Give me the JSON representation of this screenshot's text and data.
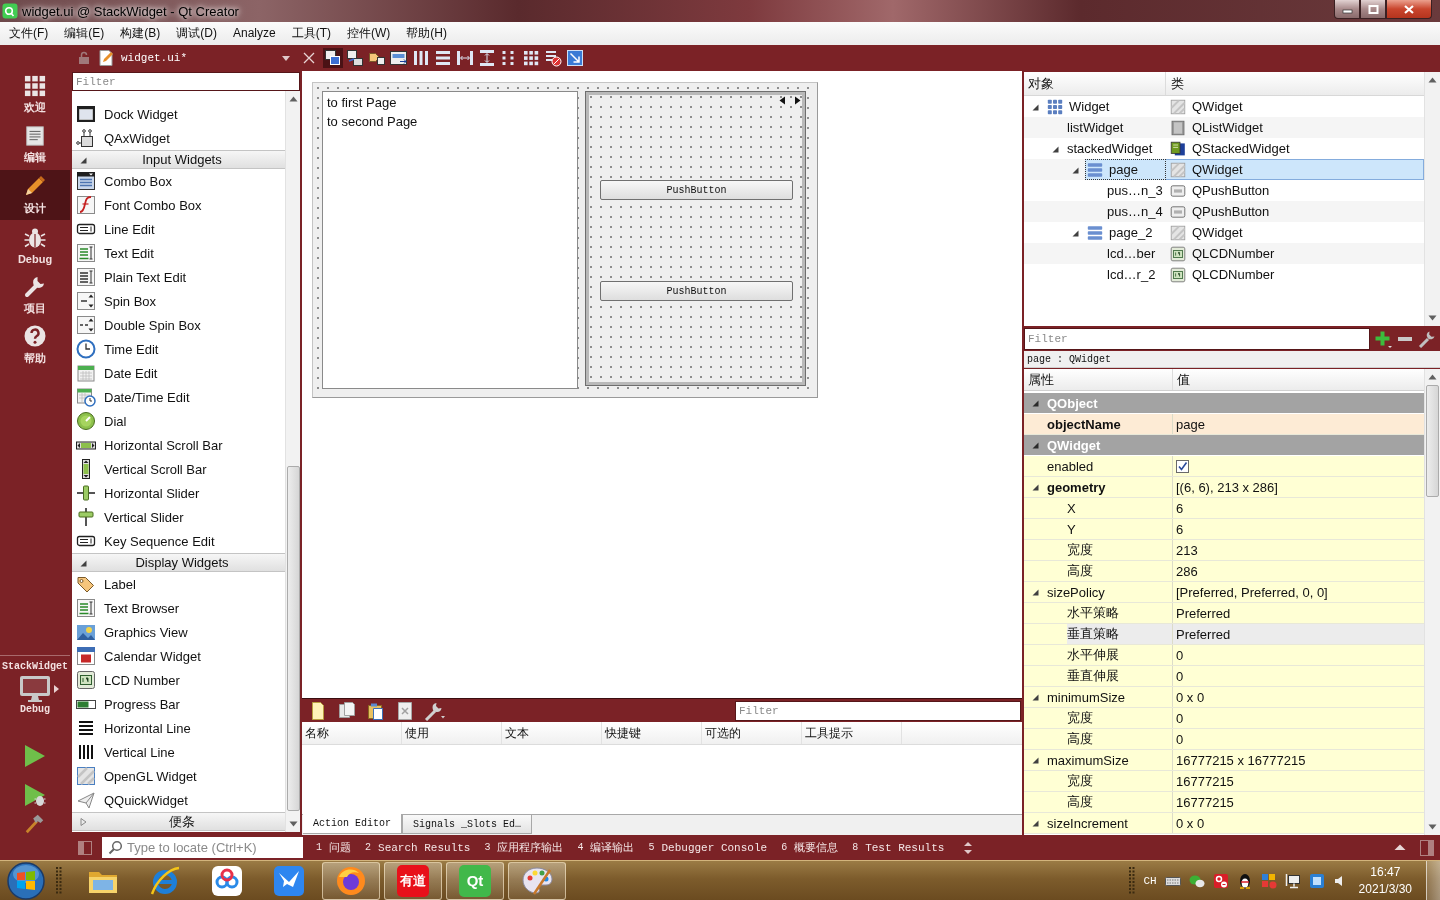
{
  "window": {
    "title": "widget.ui @ StackWidget - Qt Creator"
  },
  "menu": [
    "文件(F)",
    "编辑(E)",
    "构建(B)",
    "调试(D)",
    "Analyze",
    "工具(T)",
    "控件(W)",
    "帮助(H)"
  ],
  "modes": [
    {
      "label": "欢迎",
      "kind": "welcome",
      "selected": false
    },
    {
      "label": "编辑",
      "kind": "edit",
      "selected": false
    },
    {
      "label": "设计",
      "kind": "design",
      "selected": true
    },
    {
      "label": "Debug",
      "kind": "debug",
      "selected": false
    },
    {
      "label": "项目",
      "kind": "projects",
      "selected": false
    },
    {
      "label": "帮助",
      "kind": "help",
      "selected": false
    }
  ],
  "target": {
    "project": "StackWidget",
    "config": "Debug"
  },
  "editor_toolbar": {
    "document": "widget.ui*",
    "tools": [
      {
        "kind": "widgets",
        "checked": true
      },
      {
        "kind": "signals",
        "checked": false
      },
      {
        "kind": "buddies",
        "checked": false
      },
      {
        "kind": "taborder",
        "checked": false
      },
      {
        "kind": "hlayout",
        "checked": false
      },
      {
        "kind": "vlayout",
        "checked": false
      },
      {
        "kind": "hsplit",
        "checked": false
      },
      {
        "kind": "vsplit",
        "checked": false
      },
      {
        "kind": "formlayout",
        "checked": false
      },
      {
        "kind": "grid",
        "checked": false
      },
      {
        "kind": "break",
        "checked": false
      },
      {
        "kind": "adjust",
        "checked": false
      }
    ]
  },
  "widget_box": {
    "filter_placeholder": "Filter",
    "groups": [
      {
        "items": [
          {
            "label": "Dock Widget",
            "kind": "dock"
          },
          {
            "label": "QAxWidget",
            "kind": "activex"
          }
        ]
      },
      {
        "title": "Input Widgets",
        "expanded": true,
        "items": [
          {
            "label": "Combo Box",
            "kind": "combo"
          },
          {
            "label": "Font Combo Box",
            "kind": "font"
          },
          {
            "label": "Line Edit",
            "kind": "lineedit"
          },
          {
            "label": "Text Edit",
            "kind": "textedit"
          },
          {
            "label": "Plain Text Edit",
            "kind": "plaintext"
          },
          {
            "label": "Spin Box",
            "kind": "spin"
          },
          {
            "label": "Double Spin Box",
            "kind": "doublespin"
          },
          {
            "label": "Time Edit",
            "kind": "time"
          },
          {
            "label": "Date Edit",
            "kind": "date"
          },
          {
            "label": "Date/Time Edit",
            "kind": "datetime"
          },
          {
            "label": "Dial",
            "kind": "dial"
          },
          {
            "label": "Horizontal Scroll Bar",
            "kind": "hscroll"
          },
          {
            "label": "Vertical Scroll Bar",
            "kind": "vscroll"
          },
          {
            "label": "Horizontal Slider",
            "kind": "hslider"
          },
          {
            "label": "Vertical Slider",
            "kind": "vslider"
          },
          {
            "label": "Key Sequence Edit",
            "kind": "keyseq"
          }
        ]
      },
      {
        "title": "Display Widgets",
        "expanded": true,
        "items": [
          {
            "label": "Label",
            "kind": "label"
          },
          {
            "label": "Text Browser",
            "kind": "browser"
          },
          {
            "label": "Graphics View",
            "kind": "graphics"
          },
          {
            "label": "Calendar Widget",
            "kind": "calendar"
          },
          {
            "label": "LCD Number",
            "kind": "lcd"
          },
          {
            "label": "Progress Bar",
            "kind": "progress"
          },
          {
            "label": "Horizontal Line",
            "kind": "hline"
          },
          {
            "label": "Vertical Line",
            "kind": "vline"
          },
          {
            "label": "OpenGL Widget",
            "kind": "opengl"
          },
          {
            "label": "QQuickWidget",
            "kind": "quick"
          }
        ]
      },
      {
        "title": "便条",
        "expanded": false
      }
    ]
  },
  "form": {
    "list_items": [
      "to first Page",
      "to second Page"
    ],
    "buttons": [
      "PushButton",
      "PushButton"
    ]
  },
  "action_editor": {
    "filter_placeholder": "Filter",
    "columns": [
      "名称",
      "使用",
      "文本",
      "快捷键",
      "可选的",
      "工具提示"
    ],
    "tabs": [
      {
        "label": "Action Editor",
        "selected": true
      },
      {
        "label": "Signals _Slots Ed…",
        "selected": false
      }
    ]
  },
  "object_inspector": {
    "columns": [
      "对象",
      "类"
    ],
    "tree": [
      {
        "name": "Widget",
        "class": "QWidget",
        "kind": "widget",
        "layout": {
          "kind": "grid"
        },
        "expanded": true,
        "selected": false,
        "children": [
          {
            "name": "listWidget",
            "class": "QListWidget",
            "kind": "list",
            "selected": false
          },
          {
            "name": "stackedWidget",
            "class": "QStackedWidget",
            "kind": "stacked",
            "expanded": true,
            "selected": false,
            "children": [
              {
                "name": "page",
                "class": "QWidget",
                "kind": "widget",
                "layout": {
                  "kind": "vertical"
                },
                "expanded": true,
                "selected": true,
                "children": [
                  {
                    "name": "pus…n_3",
                    "class": "QPushButton",
                    "kind": "button",
                    "selected": false
                  },
                  {
                    "name": "pus…n_4",
                    "class": "QPushButton",
                    "kind": "button",
                    "selected": false
                  }
                ]
              },
              {
                "name": "page_2",
                "class": "QWidget",
                "kind": "widget",
                "layout": {
                  "kind": "vertical"
                },
                "expanded": true,
                "selected": false,
                "children": [
                  {
                    "name": "lcd…ber",
                    "class": "QLCDNumber",
                    "kind": "lcd",
                    "selected": false
                  },
                  {
                    "name": "lcd…r_2",
                    "class": "QLCDNumber",
                    "kind": "lcd",
                    "selected": false
                  }
                ]
              }
            ]
          }
        ]
      }
    ]
  },
  "property_editor": {
    "filter_placeholder": "Filter",
    "class_label": "page : QWidget",
    "columns": [
      "属性",
      "值"
    ],
    "groups": [
      {
        "name": "QObject",
        "expanded": true,
        "color": "#fdebd5",
        "properties": [
          {
            "name": "objectName",
            "kind": "text",
            "value": "page",
            "changed": true,
            "selected": false
          }
        ]
      },
      {
        "name": "QWidget",
        "expanded": true,
        "color": "#ffffd4",
        "properties": [
          {
            "name": "enabled",
            "kind": "checkbox",
            "checked": true,
            "changed": false,
            "selected": false
          },
          {
            "name": "geometry",
            "kind": "text",
            "value": "[(6, 6), 213 x 286]",
            "changed": true,
            "expanded": true,
            "selected": false,
            "children": [
              {
                "name": "X",
                "value": "6",
                "selected": false
              },
              {
                "name": "Y",
                "value": "6",
                "selected": false
              },
              {
                "name": "宽度",
                "value": "213",
                "selected": false
              },
              {
                "name": "高度",
                "value": "286",
                "selected": false
              }
            ]
          },
          {
            "name": "sizePolicy",
            "kind": "text",
            "value": "[Preferred, Preferred, 0, 0]",
            "changed": false,
            "expanded": true,
            "selected": false,
            "children": [
              {
                "name": "水平策略",
                "value": "Preferred",
                "selected": false
              },
              {
                "name": "垂直策略",
                "value": "Preferred",
                "selected": true
              },
              {
                "name": "水平伸展",
                "value": "0",
                "selected": false
              },
              {
                "name": "垂直伸展",
                "value": "0",
                "selected": false
              }
            ]
          },
          {
            "name": "minimumSize",
            "kind": "text",
            "value": "0 x 0",
            "changed": false,
            "expanded": true,
            "selected": false,
            "children": [
              {
                "name": "宽度",
                "value": "0",
                "selected": false
              },
              {
                "name": "高度",
                "value": "0",
                "selected": false
              }
            ]
          },
          {
            "name": "maximumSize",
            "kind": "text",
            "value": "16777215 x 16777215",
            "changed": false,
            "expanded": true,
            "selected": false,
            "children": [
              {
                "name": "宽度",
                "value": "16777215",
                "selected": false
              },
              {
                "name": "高度",
                "value": "16777215",
                "selected": false
              }
            ]
          },
          {
            "name": "sizeIncrement",
            "kind": "text",
            "value": "0 x 0",
            "changed": false,
            "expanded": true,
            "selected": false
          }
        ]
      }
    ]
  },
  "status_bar": {
    "locate_placeholder": "Type to locate (Ctrl+K)",
    "panes": [
      {
        "number": "1",
        "label": "问题"
      },
      {
        "number": "2",
        "label": "Search Results"
      },
      {
        "number": "3",
        "label": "应用程序输出"
      },
      {
        "number": "4",
        "label": "编译输出"
      },
      {
        "number": "5",
        "label": "Debugger Console"
      },
      {
        "number": "6",
        "label": "概要信息"
      },
      {
        "number": "8",
        "label": "Test Results"
      }
    ]
  },
  "taskbar": {
    "apps": [
      {
        "kind": "explorer",
        "running": false
      },
      {
        "kind": "ie",
        "running": false
      },
      {
        "kind": "cloud",
        "running": false
      },
      {
        "kind": "bird",
        "running": false
      },
      {
        "kind": "firefox",
        "running": true
      },
      {
        "kind": "youdao",
        "logo_text": "有道",
        "running": true
      },
      {
        "kind": "qt",
        "logo_text": "Qt",
        "running": true
      },
      {
        "kind": "paint",
        "running": true
      }
    ],
    "input_language": "CH",
    "time": "16:47",
    "date": "2021/3/30"
  }
}
